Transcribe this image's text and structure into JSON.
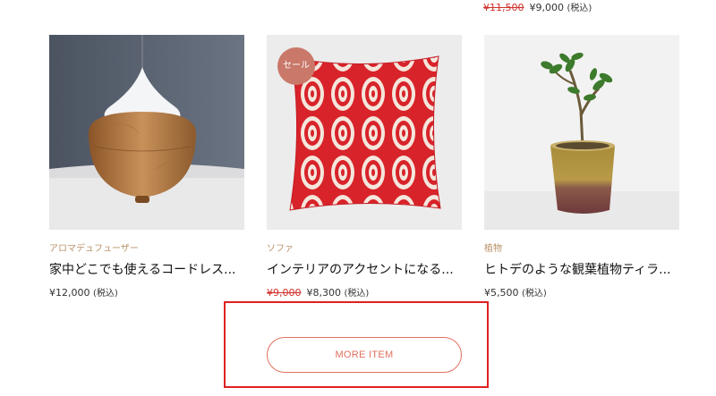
{
  "top_item": {
    "original_price": "¥11,500",
    "sale_price": "¥9,000",
    "tax_note": "(税込)"
  },
  "products": [
    {
      "category": "アロマデュフューザー",
      "name": "家中どこでも使えるコードレス...",
      "original_price": "",
      "price": "¥12,000",
      "tax_note": "(税込)"
    },
    {
      "badge": "セール",
      "category": "ソファ",
      "name": "インテリアのアクセントになる...",
      "original_price": "¥9,000",
      "price": "¥8,300",
      "tax_note": "(税込)"
    },
    {
      "category": "植物",
      "name": "ヒトデのような観葉植物ティラ...",
      "original_price": "",
      "price": "¥5,500",
      "tax_note": "(税込)"
    }
  ],
  "more_button": {
    "label": "MORE ITEM"
  },
  "colors": {
    "accent": "#e0705e",
    "sale_badge": "#c9786a",
    "category": "#b89168",
    "highlight": "#e02020"
  }
}
